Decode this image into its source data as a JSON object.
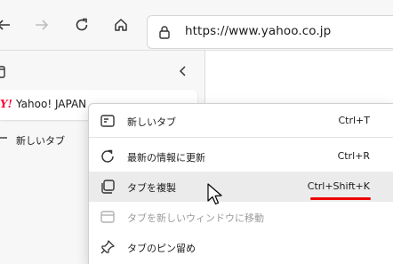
{
  "toolbar": {
    "back_icon": "back-arrow-icon",
    "forward_icon": "forward-arrow-icon",
    "refresh_icon": "refresh-icon",
    "home_icon": "home-icon",
    "address": {
      "url": "https://www.yahoo.co.jp",
      "lock_icon": "lock-icon"
    }
  },
  "sidebar": {
    "collapse_icon": "chevron-left-icon",
    "tab": {
      "favicon_text": "Y!",
      "title": "Yahoo! JAPAN"
    },
    "new_tab": {
      "icon": "plus-icon",
      "label": "新しいタブ"
    }
  },
  "context_menu": {
    "items": [
      {
        "label": "新しいタブ",
        "shortcut": "Ctrl+T",
        "icon": "new-tab-icon",
        "disabled": false
      },
      {
        "label": "最新の情報に更新",
        "shortcut": "Ctrl+R",
        "icon": "refresh-icon",
        "disabled": false
      },
      {
        "label": "タブを複製",
        "shortcut": "Ctrl+Shift+K",
        "icon": "duplicate-tab-icon",
        "disabled": false,
        "highlighted": true
      },
      {
        "label": "タブを新しいウィンドウに移動",
        "shortcut": "",
        "icon": "move-to-window-icon",
        "disabled": true
      },
      {
        "label": "タブのピン留め",
        "shortcut": "",
        "icon": "pin-icon",
        "disabled": false
      }
    ]
  },
  "colors": {
    "annotation_underline": "#ee0000",
    "highlight_bg": "#ebebeb"
  }
}
